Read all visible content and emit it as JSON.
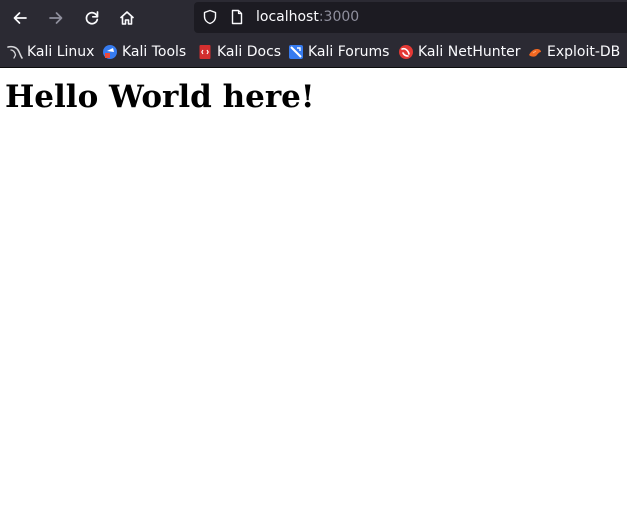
{
  "browser": {
    "colors": {
      "toolbar_bg": "#2b2a33",
      "urlbar_bg": "#1c1b22",
      "text": "#fbfbfe",
      "muted": "#8f8f9d"
    },
    "nav": {
      "back_icon": "arrow-left-icon",
      "forward_icon": "arrow-right-icon",
      "reload_icon": "reload-icon",
      "home_icon": "home-icon"
    },
    "url": {
      "host": "localhost",
      "port": ":3000",
      "shield_icon": "shield-icon",
      "page_icon": "document-icon"
    }
  },
  "bookmarks": [
    {
      "label": "Kali Linux",
      "icon": "kali-dragon-icon"
    },
    {
      "label": "Kali Tools",
      "icon": "kali-tools-icon"
    },
    {
      "label": "Kali Docs",
      "icon": "kali-docs-icon"
    },
    {
      "label": "Kali Forums",
      "icon": "kali-forums-icon"
    },
    {
      "label": "Kali NetHunter",
      "icon": "kali-nethunter-icon"
    },
    {
      "label": "Exploit-DB",
      "icon": "exploit-db-icon"
    }
  ],
  "page": {
    "heading": "Hello World here!"
  }
}
